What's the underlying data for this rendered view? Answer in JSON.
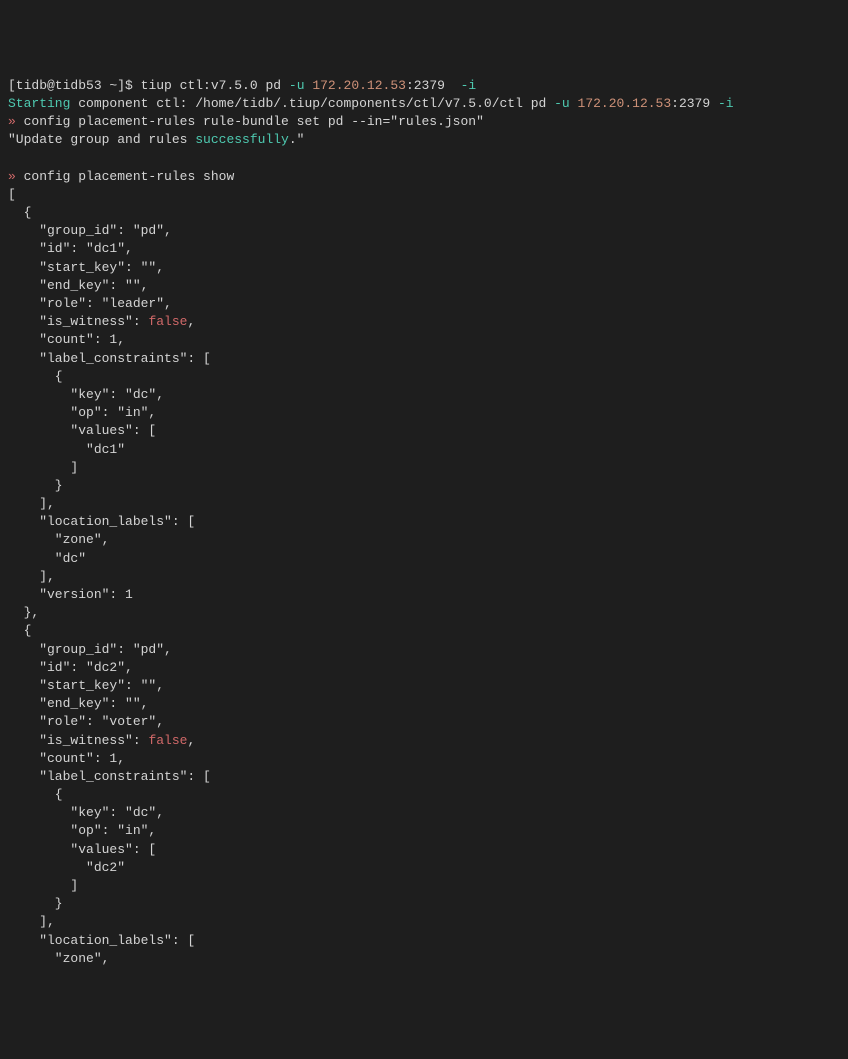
{
  "prompt": {
    "user_host": "[tidb@tidb53 ~]$",
    "command": "tiup ctl:v7.5.0 pd",
    "flag_u": "-u",
    "ip": "172.20.12.53",
    "port": ":2379",
    "flag_i": "-i"
  },
  "starting": {
    "label": "Starting",
    "rest": " component ctl: /home/tidb/.tiup/components/ctl/v7.5.0/ctl pd ",
    "flag_u": "-u",
    "ip": "172.20.12.53",
    "port": ":2379 ",
    "flag_i": "-i"
  },
  "cmd1": {
    "arrow": "»",
    "text": " config placement-rules rule-bundle set pd --in=\"rules.json\""
  },
  "result1": {
    "prefix": "\"Update group and rules ",
    "success": "successfully",
    "suffix": ".\""
  },
  "cmd2": {
    "arrow": "»",
    "text": " config placement-rules show"
  },
  "json_output": {
    "lines": [
      "[",
      "  {",
      "    \"group_id\": \"pd\",",
      "    \"id\": \"dc1\",",
      "    \"start_key\": \"\",",
      "    \"end_key\": \"\",",
      "    \"role\": \"leader\",",
      "    \"is_witness\": ",
      "    \"count\": 1,",
      "    \"label_constraints\": [",
      "      {",
      "        \"key\": \"dc\",",
      "        \"op\": \"in\",",
      "        \"values\": [",
      "          \"dc1\"",
      "        ]",
      "      }",
      "    ],",
      "    \"location_labels\": [",
      "      \"zone\",",
      "      \"dc\"",
      "    ],",
      "    \"version\": 1",
      "  },",
      "  {",
      "    \"group_id\": \"pd\",",
      "    \"id\": \"dc2\",",
      "    \"start_key\": \"\",",
      "    \"end_key\": \"\",",
      "    \"role\": \"voter\",",
      "    \"is_witness\": ",
      "    \"count\": 1,",
      "    \"label_constraints\": [",
      "      {",
      "        \"key\": \"dc\",",
      "        \"op\": \"in\",",
      "        \"values\": [",
      "          \"dc2\"",
      "        ]",
      "      }",
      "    ],",
      "    \"location_labels\": [",
      "      \"zone\","
    ],
    "false_keyword": "false",
    "false_suffix": ","
  }
}
